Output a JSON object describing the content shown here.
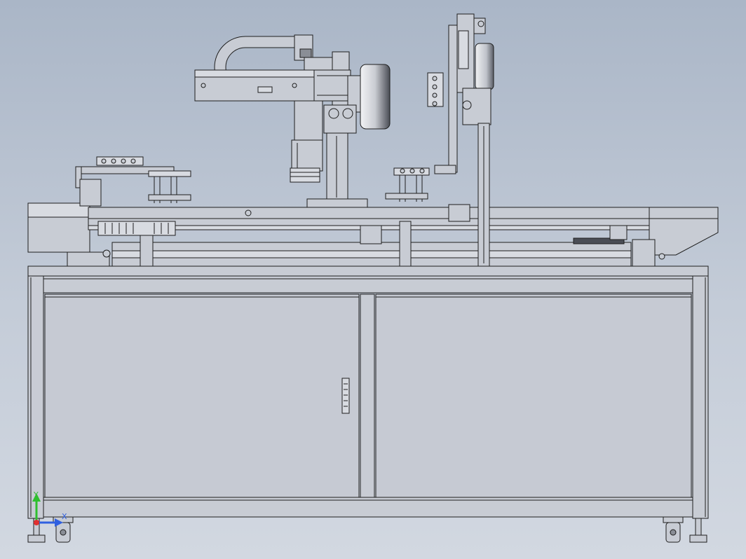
{
  "triad": {
    "y_label": "Y",
    "x_label": "X"
  },
  "colors": {
    "background_top": "#aab6c7",
    "background_bottom": "#d2d8e1",
    "metal": "#c8ccd4",
    "metal_light": "#d8dbe1",
    "line": "#1e1e1e",
    "axis_y": "#2fbf2f",
    "axis_x": "#2f5fe0",
    "axis_z": "#e03030"
  }
}
